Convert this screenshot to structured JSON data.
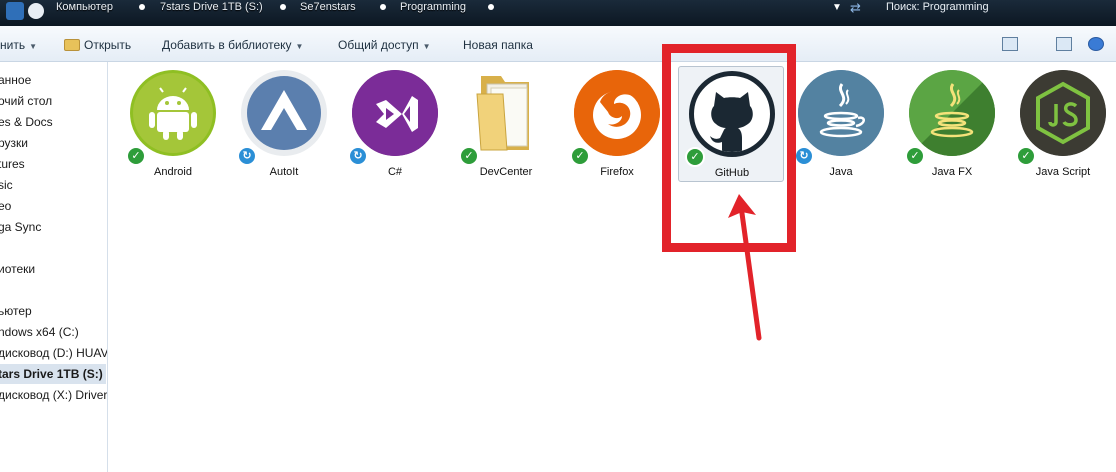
{
  "breadcrumbs": [
    "Компьютер",
    "7stars Drive 1TB (S:)",
    "Se7enstars",
    "Programming"
  ],
  "search": {
    "placeholder": "Поиск: Programming"
  },
  "toolbar": {
    "organize": "нить",
    "open": "Открыть",
    "add_to_library": "Добавить в библиотеку",
    "share": "Общий доступ",
    "new_folder": "Новая папка"
  },
  "sidebar": {
    "items": [
      "анное",
      "очий стол",
      "es & Docs",
      "рузки",
      "tures",
      "sic",
      "eo",
      "ga Sync",
      "иотеки",
      "ьютер",
      "ndows x64 (C:)",
      "дисковод (D:) HUAV",
      "tars Drive 1TB (S:)",
      "дисковод (X:) Driver"
    ],
    "selected": "tars Drive 1TB (S:)"
  },
  "files": [
    {
      "name": "Android",
      "icon": "android-icon",
      "color": "#8fbf23",
      "status": "synced"
    },
    {
      "name": "AutoIt",
      "icon": "autoit-icon",
      "color": "#5b7fae",
      "status": "syncing"
    },
    {
      "name": "C#",
      "icon": "visual-studio-icon",
      "color": "#68217a",
      "status": "syncing"
    },
    {
      "name": "DevCenter",
      "icon": "folder-icon",
      "color": "#e8c25a",
      "status": "synced"
    },
    {
      "name": "Firefox",
      "icon": "firefox-icon",
      "color": "#e66000",
      "status": "synced"
    },
    {
      "name": "GitHub",
      "icon": "github-icon",
      "color": "#1b2833",
      "status": "synced"
    },
    {
      "name": "Java",
      "icon": "java-icon",
      "color": "#4e7ca6",
      "status": "syncing"
    },
    {
      "name": "Java FX",
      "icon": "javafx-icon",
      "color": "#4d9a3c",
      "status": "synced"
    },
    {
      "name": "Java Script",
      "icon": "nodejs-icon",
      "color": "#3a3a32",
      "status": "synced"
    }
  ],
  "annotation_color": "#e2232a"
}
